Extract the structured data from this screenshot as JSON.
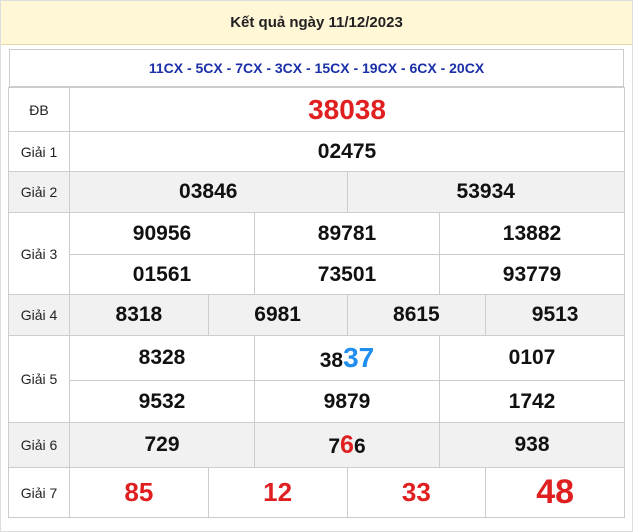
{
  "header": {
    "title": "Kết quả ngày 11/12/2023"
  },
  "codes": "11CX - 5CX - 7CX - 3CX - 15CX - 19CX - 6CX - 20CX",
  "labels": {
    "db": "ĐB",
    "g1": "Giải 1",
    "g2": "Giải 2",
    "g3": "Giải 3",
    "g4": "Giải 4",
    "g5": "Giải 5",
    "g6": "Giải 6",
    "g7": "Giải 7"
  },
  "prizes": {
    "db": "38038",
    "g1": "02475",
    "g2": [
      "03846",
      "53934"
    ],
    "g3": [
      "90956",
      "89781",
      "13882",
      "01561",
      "73501",
      "93779"
    ],
    "g4": [
      "8318",
      "6981",
      "8615",
      "9513"
    ],
    "g5": [
      {
        "pre": "8328",
        "hl": "",
        "post": ""
      },
      {
        "pre": "38",
        "hl": "37",
        "post": ""
      },
      {
        "pre": "0107",
        "hl": "",
        "post": ""
      },
      {
        "pre": "9532",
        "hl": "",
        "post": ""
      },
      {
        "pre": "9879",
        "hl": "",
        "post": ""
      },
      {
        "pre": "1742",
        "hl": "",
        "post": ""
      }
    ],
    "g6": [
      {
        "pre": "729",
        "hl": "",
        "post": ""
      },
      {
        "pre": "7",
        "hl": "6",
        "post": "6"
      },
      {
        "pre": "938",
        "hl": "",
        "post": ""
      }
    ],
    "g7": [
      "85",
      "12",
      "33",
      "48"
    ]
  },
  "colors": {
    "special": "#e02020",
    "highlight_blue": "#1f8ef0",
    "highlight_red": "#e02020",
    "codes": "#1a2fa8",
    "header_bg": "#fff7d6"
  }
}
